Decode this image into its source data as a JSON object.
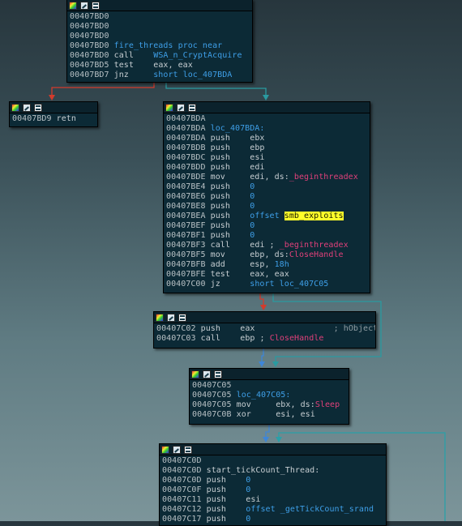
{
  "colors": {
    "edge_false": "#d23b2c",
    "edge_true": "#2a9aa0",
    "edge_uncond": "#3e86d8",
    "edge_back": "#2aa0a8"
  },
  "nodes": {
    "fire_threads": {
      "lines": [
        {
          "addr": "00407BD0",
          "mn": "",
          "op": ""
        },
        {
          "addr": "00407BD0",
          "mn": "",
          "op": ""
        },
        {
          "addr": "00407BD0",
          "mn": "",
          "op": ""
        },
        {
          "addr": "00407BD0",
          "mn": "fire_threads proc near",
          "op": ""
        },
        {
          "addr": "00407BD0",
          "mn": "call",
          "op": "WSA_n_CryptAcquire"
        },
        {
          "addr": "00407BD5",
          "mn": "test",
          "op": "eax, eax"
        },
        {
          "addr": "00407BD7",
          "mn": "jnz",
          "op": "short loc_407BDA"
        }
      ]
    },
    "retn": {
      "lines": [
        {
          "addr": "00407BD9",
          "mn": "retn",
          "op": ""
        }
      ]
    },
    "loc_407BDA": {
      "lines": [
        {
          "addr": "00407BDA",
          "mn": "",
          "op": ""
        },
        {
          "addr": "00407BDA",
          "mn": "loc_407BDA:",
          "op": ""
        },
        {
          "addr": "00407BDA",
          "mn": "push",
          "op": "ebx"
        },
        {
          "addr": "00407BDB",
          "mn": "push",
          "op": "ebp"
        },
        {
          "addr": "00407BDC",
          "mn": "push",
          "op": "esi"
        },
        {
          "addr": "00407BDD",
          "mn": "push",
          "op": "edi"
        },
        {
          "addr": "00407BDE",
          "mn": "mov",
          "op": "edi, ds:",
          "op2": "_beginthreadex"
        },
        {
          "addr": "00407BE4",
          "mn": "push",
          "op": "0"
        },
        {
          "addr": "00407BE6",
          "mn": "push",
          "op": "0"
        },
        {
          "addr": "00407BE8",
          "mn": "push",
          "op": "0"
        },
        {
          "addr": "00407BEA",
          "mn": "push",
          "op": "offset ",
          "op2": "smb_exploits"
        },
        {
          "addr": "00407BEF",
          "mn": "push",
          "op": "0"
        },
        {
          "addr": "00407BF1",
          "mn": "push",
          "op": "0"
        },
        {
          "addr": "00407BF3",
          "mn": "call",
          "op": "edi ; ",
          "op2": "_beginthreadex"
        },
        {
          "addr": "00407BF5",
          "mn": "mov",
          "op": "ebp, ds:",
          "op2": "CloseHandle"
        },
        {
          "addr": "00407BFB",
          "mn": "add",
          "op": "esp, ",
          "op2": "18h"
        },
        {
          "addr": "00407BFE",
          "mn": "test",
          "op": "eax, eax"
        },
        {
          "addr": "00407C00",
          "mn": "jz",
          "op": "short loc_407C05"
        }
      ]
    },
    "closehandle_block": {
      "lines": [
        {
          "addr": "00407C02",
          "mn": "push",
          "op": "eax",
          "comment": "; hObject"
        },
        {
          "addr": "00407C03",
          "mn": "call",
          "op": "ebp ; ",
          "op2": "CloseHandle"
        }
      ]
    },
    "loc_407C05": {
      "lines": [
        {
          "addr": "00407C05",
          "mn": "",
          "op": ""
        },
        {
          "addr": "00407C05",
          "mn": "loc_407C05:",
          "op": ""
        },
        {
          "addr": "00407C05",
          "mn": "mov",
          "op": "ebx, ds:",
          "op2": "Sleep"
        },
        {
          "addr": "00407C0B",
          "mn": "xor",
          "op": "esi, esi"
        }
      ]
    },
    "start_tickCount_Thread": {
      "lines": [
        {
          "addr": "00407C0D",
          "mn": "",
          "op": ""
        },
        {
          "addr": "00407C0D",
          "mn": "start_tickCount_Thread:",
          "op": ""
        },
        {
          "addr": "00407C0D",
          "mn": "push",
          "op": "0"
        },
        {
          "addr": "00407C0F",
          "mn": "push",
          "op": "0"
        },
        {
          "addr": "00407C11",
          "mn": "push",
          "op": "esi"
        },
        {
          "addr": "00407C12",
          "mn": "push",
          "op": "offset ",
          "op2": "_getTickCount_srand"
        },
        {
          "addr": "00407C17",
          "mn": "push",
          "op": "0"
        }
      ]
    }
  }
}
